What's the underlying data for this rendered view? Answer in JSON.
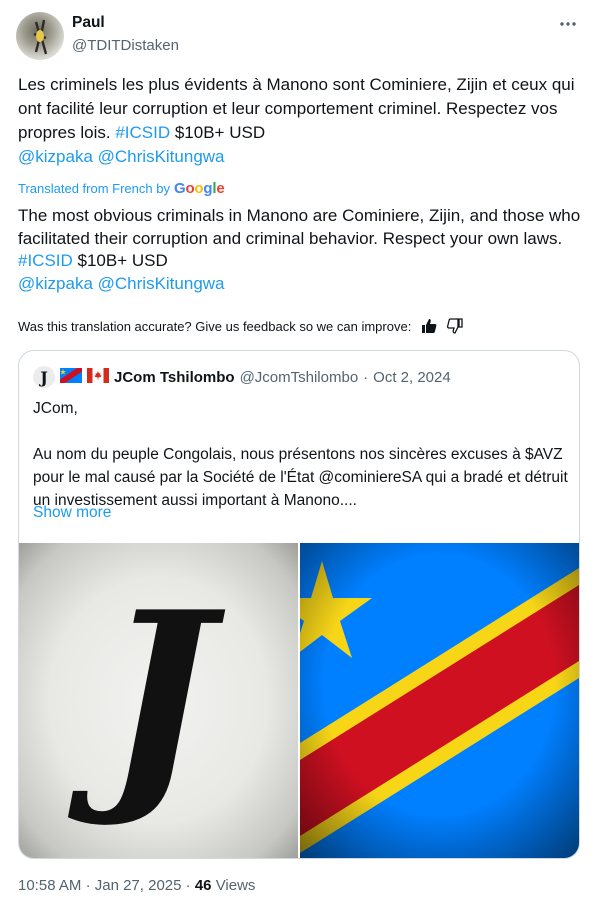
{
  "author": {
    "name": "Paul",
    "handle": "@TDITDistaken",
    "more_icon": "ellipsis-icon"
  },
  "tweet": {
    "original": {
      "text": "Les criminels les plus évidents à Manono sont Cominiere, Zijin et ceux qui ont facilité leur corruption et leur comportement criminel. Respectez vos propres lois. ",
      "hashtag": "#ICSID",
      "amount": " $10B+ USD",
      "mention1": "@kizpaka",
      "mention2": "@ChrisKitungwa"
    },
    "translated_label": "Translated from French by",
    "translator": "Google",
    "translation": {
      "text": "The most obvious criminals in Manono are Cominiere, Zijin, and those who facilitated their corruption and criminal behavior. Respect your own laws. ",
      "hashtag": "#ICSID",
      "amount": " $10B+ USD",
      "mention1": "@kizpaka",
      "mention2": "@ChrisKitungwa"
    },
    "feedback_question": "Was this translation accurate? Give us feedback so we can improve:"
  },
  "quoted": {
    "name": "JCom Tshilombo",
    "handle": "@JcomTshilombo",
    "separator": "·",
    "date": "Oct 2, 2024",
    "avatar_letter": "J",
    "body_line1": "JCom,",
    "body_paragraph": "Au nom du peuple Congolais, nous présentons nos sincères excuses à $AVZ pour le mal causé par la Société de l'État @cominiereSA qui a bradé et détruit un investissement aussi important à Manono....",
    "show_more": "Show more",
    "media": [
      "gothic-j-image",
      "drc-flag-image"
    ],
    "image_letter": "J"
  },
  "footer": {
    "time": "10:58 AM",
    "sep1": "·",
    "date": "Jan 27, 2025",
    "sep2": "·",
    "views_count": "46",
    "views_label": "Views"
  },
  "colors": {
    "link": "#1d9bf0",
    "muted": "#536471",
    "text": "#0f1419",
    "border": "#cfd9de",
    "flag_blue": "#007fff",
    "flag_yellow": "#f7d618",
    "flag_red": "#ce1021"
  }
}
